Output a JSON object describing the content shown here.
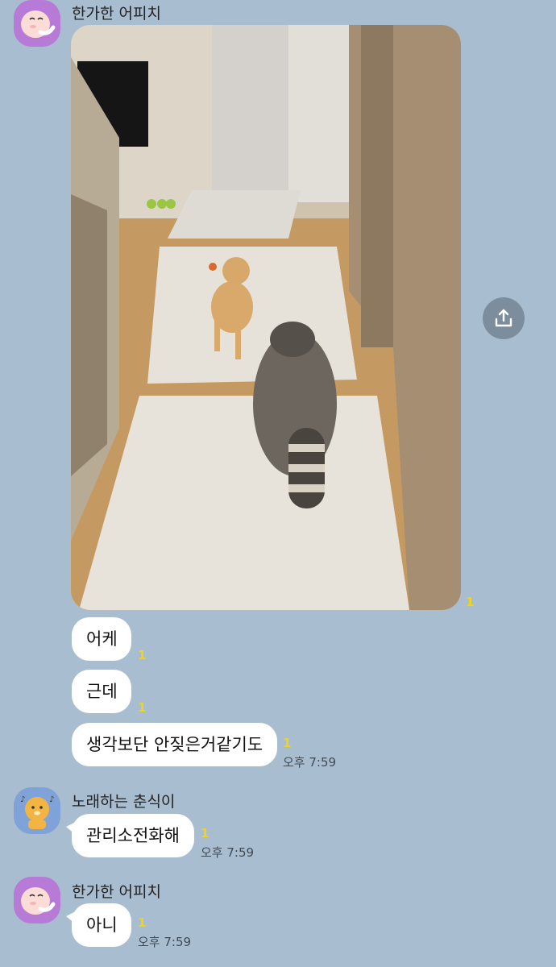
{
  "messages": {
    "group1": {
      "sender": "한가한 어피치",
      "photo_unread": "1",
      "bubbles": [
        {
          "text": "어케",
          "unread": "1"
        },
        {
          "text": "근데",
          "unread": "1"
        },
        {
          "text": "생각보단 안짖은거같기도",
          "unread": "1",
          "time": "오후 7:59"
        }
      ]
    },
    "group2": {
      "sender": "노래하는 춘식이",
      "bubbles": [
        {
          "text": "관리소전화해",
          "unread": "1",
          "time": "오후 7:59"
        }
      ]
    },
    "group3": {
      "sender": "한가한 어피치",
      "bubbles": [
        {
          "text": "아니",
          "unread": "1",
          "time": "오후 7:59"
        }
      ]
    }
  },
  "icons": {
    "share": "share-icon",
    "avatar_peach": "apeach-avatar",
    "avatar_lion": "choonsik-avatar"
  },
  "colors": {
    "background": "#a9bdd0",
    "bubble": "#ffffff",
    "unread": "#f2d414"
  }
}
